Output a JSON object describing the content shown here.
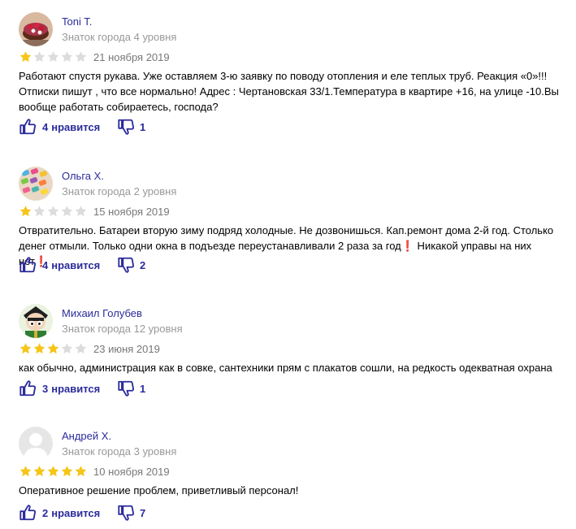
{
  "colors": {
    "accent": "#2b2b9c",
    "star_filled": "#f5c518",
    "star_empty": "#dcdcdc",
    "muted": "#999999"
  },
  "icons": {
    "like": "thumbs-up-icon",
    "dislike": "thumbs-down-icon",
    "star": "star-icon"
  },
  "reviews": [
    {
      "author": "Toni T.",
      "level": "Знаток города 4 уровня",
      "rating": 1,
      "date": "21 ноября 2019",
      "avatar": "cake",
      "text": "Работают спустя рукава. Уже оставляем 3-ю заявку по поводу отопления и еле теплых труб. Реакция «0»!!! Отписки пишут , что все нормально! Адрес : Чертановская 33/1.Температура в квартире +16, на улице -10.Вы вообще работать собираетесь, господа?",
      "likes_count": "4",
      "likes_label": "нравится",
      "dislikes_count": "1"
    },
    {
      "author": "Ольга Х.",
      "level": "Знаток города 2 уровня",
      "rating": 1,
      "date": "15 ноября 2019",
      "avatar": "colors",
      "text": "Отвратительно. Батареи вторую зиму подряд холодные. Не дозвонишься. Кап.ремонт дома 2-й год. Столько денег отмыли. Только одни окна в подъезде переустанавливали 2 раза за год❗ Никакой управы на них нет❗",
      "likes_count": "4",
      "likes_label": "нравится",
      "dislikes_count": "2"
    },
    {
      "author": "Михаил Голубев",
      "level": "Знаток города 12 уровня",
      "rating": 3,
      "date": "23 июня 2019",
      "avatar": "cartoon",
      "text": "как обычно, администрация как в совке, сантехники прям с плакатов сошли, на редкость одекватная охрана",
      "likes_count": "3",
      "likes_label": "нравится",
      "dislikes_count": "1"
    },
    {
      "author": "Андрей Х.",
      "level": "Знаток города 3 уровня",
      "rating": 5,
      "date": "10 ноября 2019",
      "avatar": "default",
      "text": "Оперативное решение проблем, приветливый персонал!",
      "likes_count": "2",
      "likes_label": "нравится",
      "dislikes_count": "7"
    }
  ]
}
